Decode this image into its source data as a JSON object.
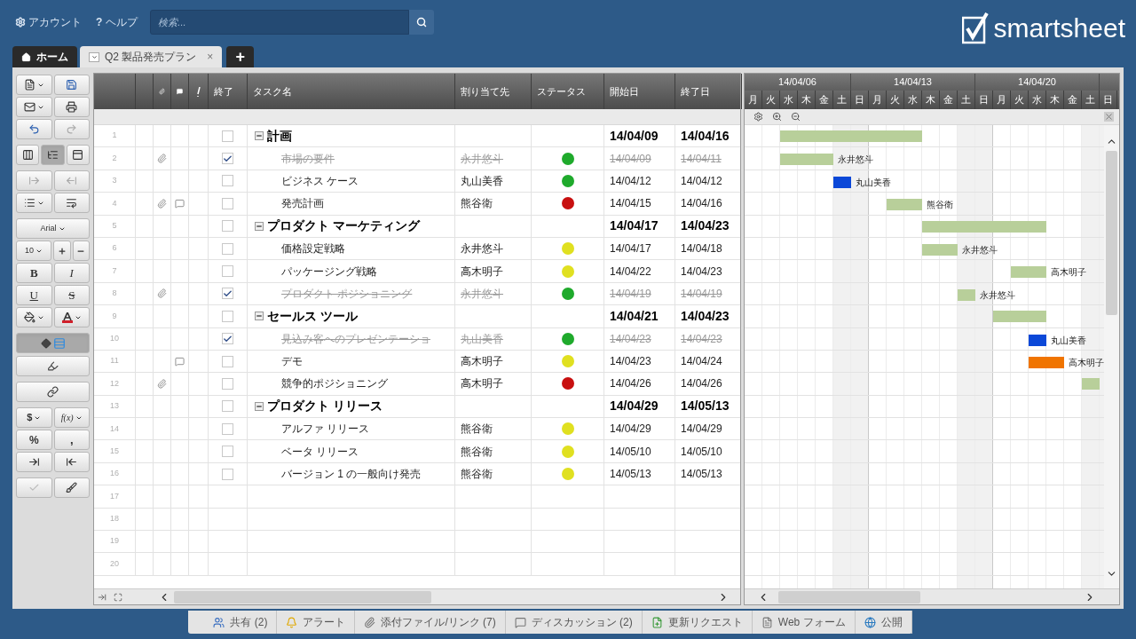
{
  "topbar": {
    "account": "アカウント",
    "help_glyph": "?",
    "help": "ヘルプ",
    "search": {
      "placeholder": "検索..."
    },
    "logo": "smartsheet"
  },
  "tabs": [
    {
      "kind": "home",
      "label": "ホーム",
      "selected": false
    },
    {
      "kind": "sheet",
      "label": "Q2 製品発売プラン",
      "selected": true,
      "close": "×"
    }
  ],
  "add_tab": "+",
  "toolbar": {
    "views": [
      {
        "selected": false
      },
      {
        "selected": true
      },
      {
        "selected": false
      }
    ],
    "font": "Arial",
    "size": "10",
    "bold": "B",
    "italic": "I",
    "underline": "U",
    "strike": "S",
    "currency": "$",
    "function": "f(x)",
    "percent": "%",
    "comma": ",",
    "highlight_changes": true
  },
  "columns": [
    "終了",
    "タスク名",
    "割り当て先",
    "ステータス",
    "開始日",
    "終了日"
  ],
  "rows": [
    {
      "num": "1",
      "kind": "section",
      "expanded": true,
      "attachment": false,
      "comment": false,
      "done": false,
      "task": "計画",
      "start": "14/04/09",
      "end": "14/04/16",
      "bar": {
        "color": "#b8cf9a"
      }
    },
    {
      "num": "2",
      "kind": "task",
      "attachment": true,
      "comment": false,
      "done": true,
      "task": "市場の要件",
      "assignee": "永井悠斗",
      "status": {
        "color": "#1faa2c"
      },
      "start": "14/04/09",
      "end": "14/04/11",
      "bar": {
        "color": "#b8cf9a",
        "label": "永井悠斗"
      }
    },
    {
      "num": "3",
      "kind": "task",
      "attachment": false,
      "comment": false,
      "done": false,
      "task": "ビジネス ケース",
      "assignee": "丸山美香",
      "status": {
        "color": "#1faa2c"
      },
      "start": "14/04/12",
      "end": "14/04/12",
      "bar": {
        "color": "#0b48d8",
        "label": "丸山美香"
      }
    },
    {
      "num": "4",
      "kind": "task",
      "attachment": true,
      "comment": true,
      "done": false,
      "task": "発売計画",
      "assignee": "熊谷衛",
      "status": {
        "color": "#c81010"
      },
      "start": "14/04/15",
      "end": "14/04/16",
      "bar": {
        "color": "#b8cf9a",
        "label": "熊谷衛"
      }
    },
    {
      "num": "5",
      "kind": "section",
      "expanded": true,
      "attachment": false,
      "comment": false,
      "done": false,
      "task": "プロダクト マーケティング",
      "start": "14/04/17",
      "end": "14/04/23",
      "bar": {
        "color": "#b8cf9a"
      }
    },
    {
      "num": "6",
      "kind": "task",
      "attachment": false,
      "comment": false,
      "done": false,
      "task": "価格設定戦略",
      "assignee": "永井悠斗",
      "status": {
        "color": "#e0e020"
      },
      "start": "14/04/17",
      "end": "14/04/18",
      "bar": {
        "color": "#b8cf9a",
        "label": "永井悠斗"
      }
    },
    {
      "num": "7",
      "kind": "task",
      "attachment": false,
      "comment": false,
      "done": false,
      "task": "パッケージング戦略",
      "assignee": "高木明子",
      "status": {
        "color": "#e0e020"
      },
      "start": "14/04/22",
      "end": "14/04/23",
      "bar": {
        "color": "#b8cf9a",
        "label": "高木明子"
      }
    },
    {
      "num": "8",
      "kind": "task",
      "attachment": true,
      "comment": false,
      "done": true,
      "task": "プロダクト ポジショニング",
      "assignee": "永井悠斗",
      "status": {
        "color": "#1faa2c"
      },
      "start": "14/04/19",
      "end": "14/04/19",
      "bar": {
        "color": "#b8cf9a",
        "label": "永井悠斗"
      }
    },
    {
      "num": "9",
      "kind": "section",
      "expanded": true,
      "attachment": false,
      "comment": false,
      "done": false,
      "task": "セールス ツール",
      "start": "14/04/21",
      "end": "14/04/23",
      "bar": {
        "color": "#b8cf9a"
      }
    },
    {
      "num": "10",
      "kind": "task",
      "attachment": false,
      "comment": false,
      "done": true,
      "task": "見込み客へのプレゼンテーショ",
      "assignee": "丸山美香",
      "status": {
        "color": "#1faa2c"
      },
      "start": "14/04/23",
      "end": "14/04/23",
      "bar": {
        "color": "#0b48d8",
        "label": "丸山美香"
      }
    },
    {
      "num": "11",
      "kind": "task",
      "attachment": false,
      "comment": true,
      "done": false,
      "task": "デモ",
      "assignee": "高木明子",
      "status": {
        "color": "#e0e020"
      },
      "start": "14/04/23",
      "end": "14/04/24",
      "bar": {
        "color": "#f07400",
        "label": "高木明子"
      }
    },
    {
      "num": "12",
      "kind": "task",
      "attachment": true,
      "comment": false,
      "done": false,
      "task": "競争的ポジショニング",
      "assignee": "高木明子",
      "status": {
        "color": "#c81010"
      },
      "start": "14/04/26",
      "end": "14/04/26",
      "bar": {
        "color": "#b8cf9a"
      }
    },
    {
      "num": "13",
      "kind": "section",
      "expanded": true,
      "attachment": false,
      "comment": false,
      "done": false,
      "task": "プロダクト リリース",
      "start": "14/04/29",
      "end": "14/05/13"
    },
    {
      "num": "14",
      "kind": "task",
      "attachment": false,
      "comment": false,
      "done": false,
      "task": "アルファ リリース",
      "assignee": "熊谷衛",
      "status": {
        "color": "#e0e020"
      },
      "start": "14/04/29",
      "end": "14/04/29"
    },
    {
      "num": "15",
      "kind": "task",
      "attachment": false,
      "comment": false,
      "done": false,
      "task": "ベータ リリース",
      "assignee": "熊谷衛",
      "status": {
        "color": "#e0e020"
      },
      "start": "14/05/10",
      "end": "14/05/10"
    },
    {
      "num": "16",
      "kind": "task",
      "attachment": false,
      "comment": false,
      "done": false,
      "task": "バージョン 1 の一般向け発売",
      "assignee": "熊谷衛",
      "status": {
        "color": "#e0e020"
      },
      "start": "14/05/13",
      "end": "14/05/13"
    },
    {
      "num": "17",
      "kind": "empty"
    },
    {
      "num": "18",
      "kind": "empty"
    },
    {
      "num": "19",
      "kind": "empty"
    },
    {
      "num": "20",
      "kind": "empty"
    }
  ],
  "gantt": {
    "weeks": [
      "14/04/06",
      "14/04/13",
      "14/04/20"
    ],
    "days": [
      "月",
      "火",
      "水",
      "木",
      "金",
      "土",
      "日",
      "月",
      "火",
      "水",
      "木",
      "金",
      "土",
      "日",
      "月",
      "火",
      "水",
      "木",
      "金",
      "土",
      "日"
    ]
  },
  "bottom_tabs": [
    "共有 (2)",
    "アラート",
    "添付ファイル/リンク (7)",
    "ディスカッション (2)",
    "更新リクエスト",
    "Web フォーム",
    "公開"
  ]
}
